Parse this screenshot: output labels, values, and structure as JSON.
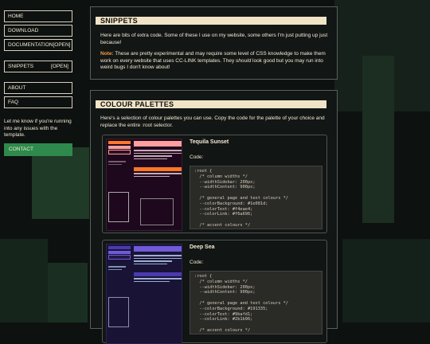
{
  "nav": {
    "items": [
      {
        "label": "HOME",
        "tag": ""
      },
      {
        "label": "DOWNLOAD",
        "tag": ""
      },
      {
        "label": "DOCUMENTATION",
        "tag": "[OPEN]"
      },
      {
        "label": "SNIPPETS",
        "tag": "[OPEN]"
      },
      {
        "label": "ABOUT",
        "tag": ""
      },
      {
        "label": "FAQ",
        "tag": ""
      }
    ],
    "note": "Let me know if you're running into any issues with the template.",
    "contact_label": "CONTACT"
  },
  "snippets": {
    "title": "SNIPPETS",
    "intro": "Here are bits of extra code. Some of these I use on my website, some others I'm just putting up just because!",
    "note_label": "Note:",
    "note_text_a": " These are pretty experimental and may require some level of CSS knowledge to make them work on every website that uses CC-LINK templates. They ",
    "note_emph": "should",
    "note_text_b": " look good but you may run into weird bugs I don't know about!"
  },
  "palettes": {
    "title": "COLOUR PALETTES",
    "intro": "Here's a selection of colour palettes you can use. Copy the code for the palette of your choice and replace the entire :root selector.",
    "code_label": "Code:",
    "items": [
      {
        "name": "Tequila Sunset",
        "code": ":root {\n  /* column widths */\n  --widthSidebar: 200px;\n  --widthContent: 900px;\n\n  /* general page and text colours */\n  --colorBackground: #1e081d;\n  --colorText: #f4eae4;\n  --colorLink: #f6a696;\n\n  /* accent colours */\n  --colorPrimary: #ff9e9e;\n  --colorSecondary: #ff7726;",
        "colors": {
          "bg": "#1e081d",
          "accent": "#ff7726",
          "primary": "#ff9e9e",
          "text": "#f4eae4"
        }
      },
      {
        "name": "Deep Sea",
        "code": ":root {\n  /* column widths */\n  --widthSidebar: 200px;\n  --widthContent: 900px;\n\n  /* general page and text colours */\n  --colorBackground: #191335;\n  --colorText: #9bafd1;\n  --colorLink: #2b1b96;\n\n  /* accent colours */",
        "colors": {
          "bg": "#191335",
          "accent": "#6f5bd6",
          "primary": "#4a3ab0",
          "text": "#9bafd1"
        }
      }
    ]
  },
  "colors": {
    "page_bg": "#0d1110",
    "title_bar": "#f0e3c6",
    "contact_bg": "#2d8a4c",
    "note_accent": "#f29a45"
  }
}
